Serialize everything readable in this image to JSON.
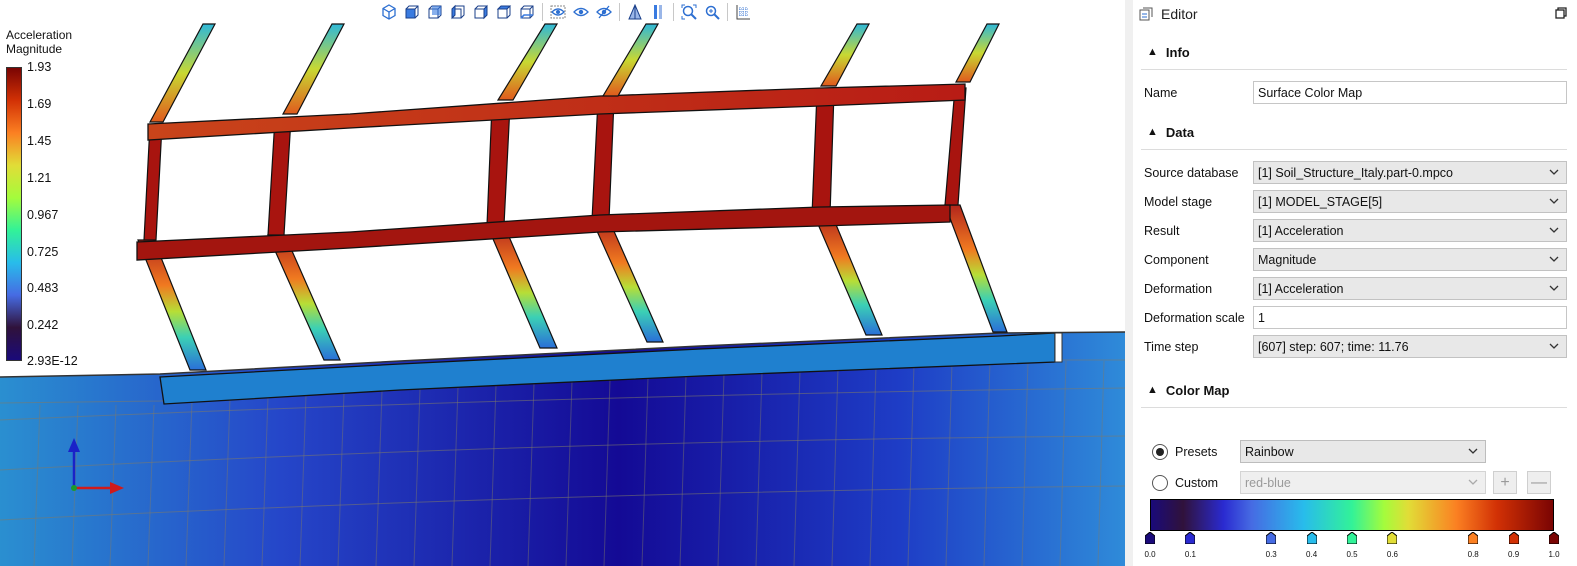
{
  "legend": {
    "title": "Acceleration\nMagnitude",
    "values": [
      "1.93",
      "1.69",
      "1.45",
      "1.21",
      "0.967",
      "0.725",
      "0.483",
      "0.242",
      "2.93E-12"
    ]
  },
  "toolbar": {
    "icons": [
      "view-iso-icon",
      "view-front-icon",
      "view-back-icon",
      "view-left-icon",
      "view-right-icon",
      "view-top-icon",
      "view-bottom-icon",
      "show-all-icon",
      "show-icon",
      "hide-icon",
      "perspective-icon",
      "orthographic-icon",
      "zoom-fit-icon",
      "zoom-selection-icon",
      "grid-icon"
    ]
  },
  "editor": {
    "title": "Editor",
    "info": {
      "header": "Info",
      "name_label": "Name",
      "name_value": "Surface Color Map"
    },
    "data": {
      "header": "Data",
      "source_label": "Source database",
      "source_value": "[1] Soil_Structure_Italy.part-0.mpco",
      "stage_label": "Model stage",
      "stage_value": "[1] MODEL_STAGE[5]",
      "result_label": "Result",
      "result_value": "[1] Acceleration",
      "component_label": "Component",
      "component_value": "Magnitude",
      "deformation_label": "Deformation",
      "deformation_value": "[1] Acceleration",
      "deformation_scale_label": "Deformation scale",
      "deformation_scale_value": "1",
      "time_step_label": "Time step",
      "time_step_value": "[607] step: 607; time: 11.76"
    },
    "color_map": {
      "header": "Color Map",
      "presets_label": "Presets",
      "presets_value": "Rainbow",
      "custom_label": "Custom",
      "custom_value": "red-blue",
      "add_symbol": "+",
      "remove_symbol": "—",
      "stops": [
        "0.0",
        "0.1",
        "0.3",
        "0.4",
        "0.5",
        "0.6",
        "0.8",
        "0.9",
        "1.0"
      ],
      "stop_colors": [
        "#1a0a7a",
        "#2a2ad0",
        "#466be3",
        "#28bceb",
        "#32f298",
        "#e1dd37",
        "#fb8022",
        "#d23105",
        "#7a0403"
      ]
    }
  }
}
